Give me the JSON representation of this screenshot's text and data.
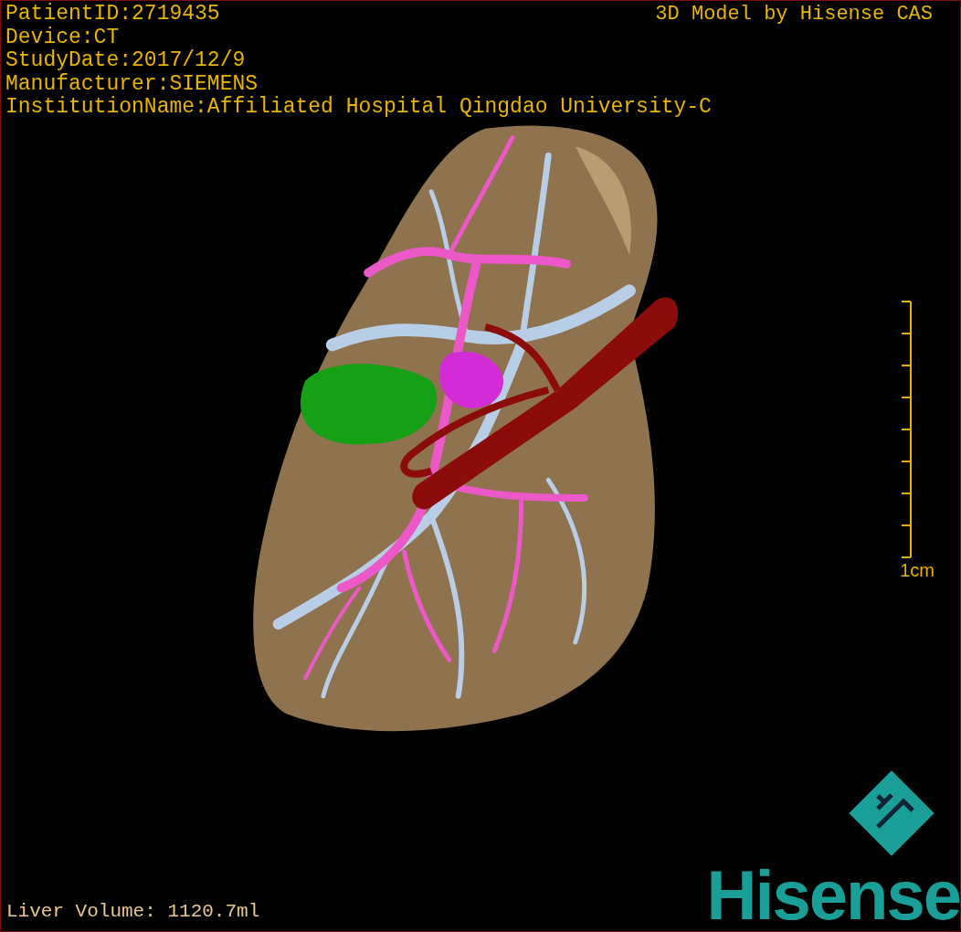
{
  "info_lines": [
    "PatientID:2719435",
    "Device:CT",
    "StudyDate:2017/12/9",
    "Manufacturer:SIEMENS",
    "InstitutionName:Affiliated Hospital Qingdao University-C"
  ],
  "title": "3D Model by Hisense CAS",
  "scale_bar": {
    "label": "1cm"
  },
  "liver_volume": "Liver Volume: 1120.7ml",
  "logo": {
    "text": "Hisense"
  }
}
